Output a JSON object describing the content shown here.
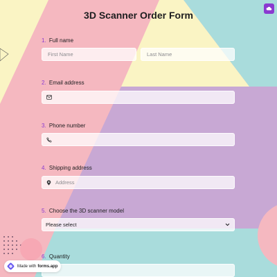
{
  "form": {
    "title": "3D Scanner Order Form",
    "questions": [
      {
        "number": "1.",
        "label": "Full name",
        "placeholders": [
          "First Name",
          "Last Name"
        ]
      },
      {
        "number": "2.",
        "label": "Email address",
        "icon": "envelope-icon"
      },
      {
        "number": "3.",
        "label": "Phone number",
        "icon": "phone-icon"
      },
      {
        "number": "4.",
        "label": "Shipping address",
        "icon": "location-pin-icon",
        "placeholder": "Address"
      },
      {
        "number": "5.",
        "label": "Choose the 3D scanner model",
        "selected": "Please select",
        "icon": "chevron-down-icon"
      },
      {
        "number": "6.",
        "label": "Quantity"
      }
    ]
  },
  "badge": {
    "prefix": "Made with",
    "brand": "forms.app",
    "icon": "forms-app-logo-icon"
  },
  "corner_button": {
    "icon": "cloud-icon"
  },
  "colors": {
    "accent": "#8a3ad0",
    "bg_pink": "#f5b8c0",
    "bg_yellow": "#f8f4c0",
    "bg_purple": "#c8a8d4",
    "bg_teal": "#a8dcdc"
  }
}
